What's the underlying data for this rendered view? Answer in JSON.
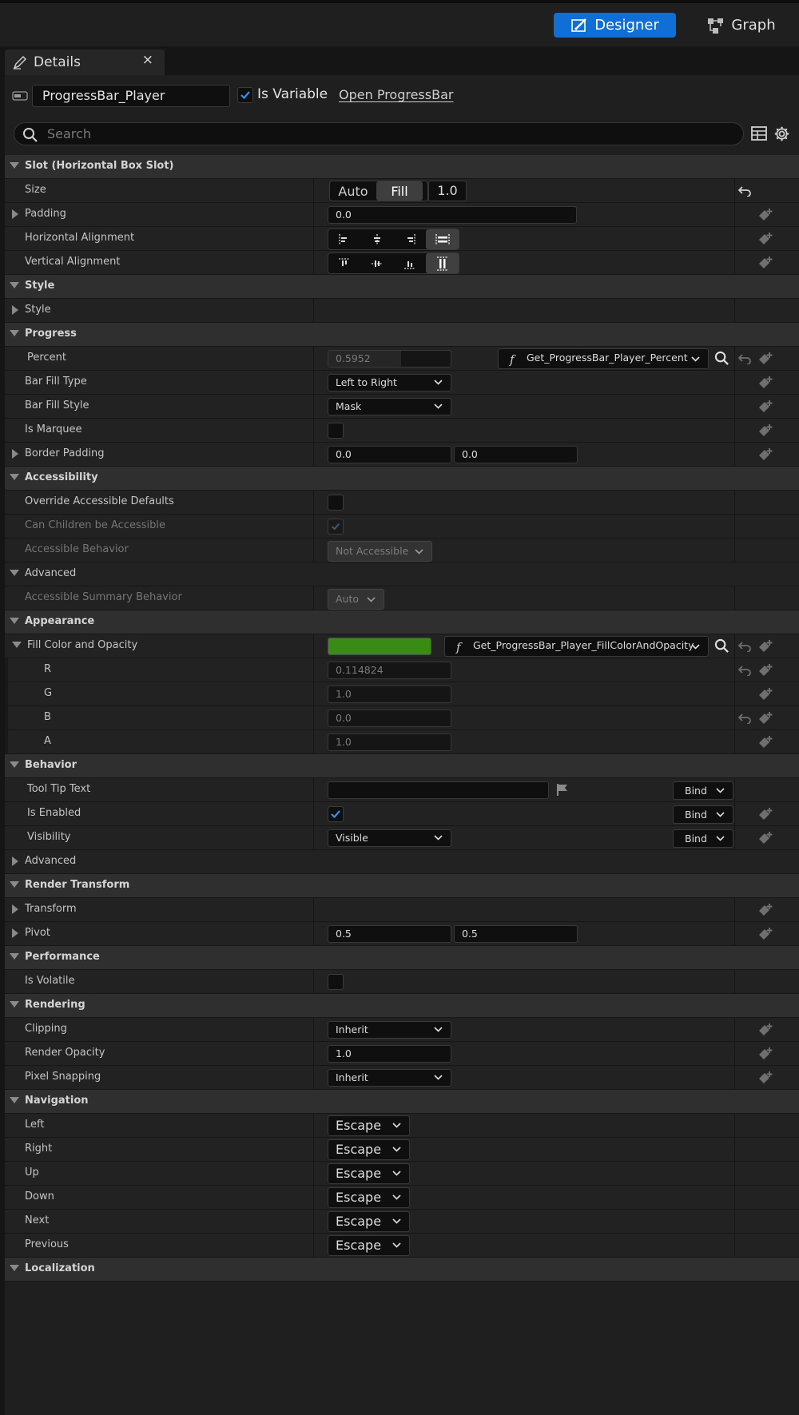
{
  "toolbar": {
    "designer_label": "Designer",
    "graph_label": "Graph"
  },
  "tab": {
    "title": "Details",
    "close": "×"
  },
  "header": {
    "widget_name": "ProgressBar_Player",
    "is_variable_label": "Is Variable",
    "is_variable_checked": true,
    "open_link": "Open ProgressBar"
  },
  "search": {
    "placeholder": "Search"
  },
  "slot": {
    "category": "Slot (Horizontal Box Slot)",
    "size_label": "Size",
    "size_auto": "Auto",
    "size_fill": "Fill",
    "size_value": "1.0",
    "padding_label": "Padding",
    "padding_value": "0.0",
    "halign_label": "Horizontal Alignment",
    "valign_label": "Vertical Alignment"
  },
  "style": {
    "category": "Style",
    "style_label": "Style"
  },
  "progress": {
    "category": "Progress",
    "percent_label": "Percent",
    "percent_value": "0.5952",
    "percent_fraction": 0.5952,
    "percent_binding": "Get_ProgressBar_Player_Percent",
    "fill_type_label": "Bar Fill Type",
    "fill_type_value": "Left to Right",
    "fill_style_label": "Bar Fill Style",
    "fill_style_value": "Mask",
    "marquee_label": "Is Marquee",
    "border_padding_label": "Border Padding",
    "border_padding_x": "0.0",
    "border_padding_y": "0.0"
  },
  "accessibility": {
    "category": "Accessibility",
    "override_label": "Override Accessible Defaults",
    "children_label": "Can Children be Accessible",
    "behavior_label": "Accessible Behavior",
    "behavior_value": "Not Accessible",
    "advanced_label": "Advanced",
    "summary_label": "Accessible Summary Behavior",
    "summary_value": "Auto"
  },
  "appearance": {
    "category": "Appearance",
    "fill_color_label": "Fill Color and Opacity",
    "fill_color": "#3a8a16",
    "fill_binding": "Get_ProgressBar_Player_FillColorAndOpacity",
    "r_label": "R",
    "r_value": "0.114824",
    "g_label": "G",
    "g_value": "1.0",
    "b_label": "B",
    "b_value": "0.0",
    "a_label": "A",
    "a_value": "1.0"
  },
  "behavior": {
    "category": "Behavior",
    "tooltip_label": "Tool Tip Text",
    "tooltip_value": "",
    "enabled_label": "Is Enabled",
    "visibility_label": "Visibility",
    "visibility_value": "Visible",
    "bind_label": "Bind",
    "advanced_label": "Advanced"
  },
  "render_transform": {
    "category": "Render Transform",
    "transform_label": "Transform",
    "pivot_label": "Pivot",
    "pivot_x": "0.5",
    "pivot_y": "0.5"
  },
  "performance": {
    "category": "Performance",
    "volatile_label": "Is Volatile"
  },
  "rendering": {
    "category": "Rendering",
    "clipping_label": "Clipping",
    "clipping_value": "Inherit",
    "opacity_label": "Render Opacity",
    "opacity_value": "1.0",
    "snapping_label": "Pixel Snapping",
    "snapping_value": "Inherit"
  },
  "navigation": {
    "category": "Navigation",
    "items": [
      {
        "label": "Left",
        "value": "Escape"
      },
      {
        "label": "Right",
        "value": "Escape"
      },
      {
        "label": "Up",
        "value": "Escape"
      },
      {
        "label": "Down",
        "value": "Escape"
      },
      {
        "label": "Next",
        "value": "Escape"
      },
      {
        "label": "Previous",
        "value": "Escape"
      }
    ]
  },
  "localization": {
    "category": "Localization"
  },
  "colors": {
    "accent": "#0f6fd6",
    "checkmark": "#3b8eea"
  }
}
